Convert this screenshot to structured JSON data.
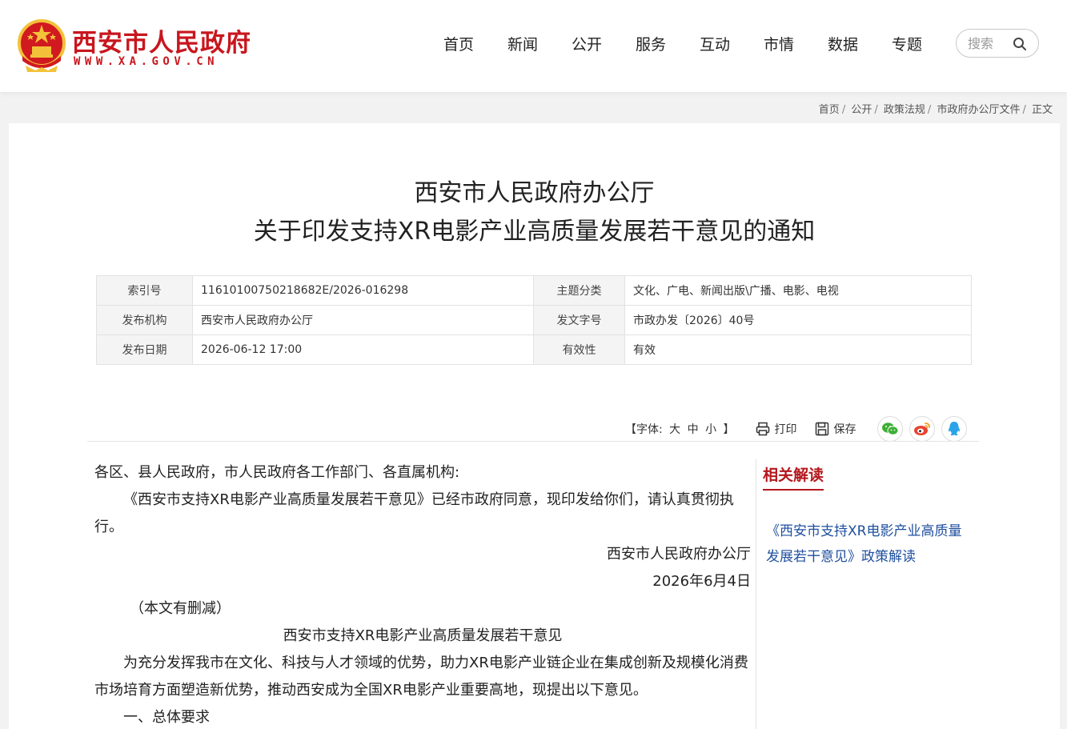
{
  "header": {
    "logo_title": "西安市人民政府",
    "logo_url": "WWW.XA.GOV.CN",
    "nav": [
      "首页",
      "新闻",
      "公开",
      "服务",
      "互动",
      "市情",
      "数据",
      "专题"
    ],
    "search_placeholder": "搜索"
  },
  "breadcrumb": [
    "首页",
    "公开",
    "政策法规",
    "市政府办公厅文件",
    "正文"
  ],
  "document": {
    "title_line1": "西安市人民政府办公厅",
    "title_line2": "关于印发支持XR电影产业高质量发展若干意见的通知",
    "meta": [
      {
        "k1": "索引号",
        "v1": "11610100750218682E/2026-016298",
        "k2": "主题分类",
        "v2": "文化、广电、新闻出版\\广播、电影、电视"
      },
      {
        "k1": "发布机构",
        "v1": "西安市人民政府办公厅",
        "k2": "发文字号",
        "v2": "市政办发〔2026〕40号"
      },
      {
        "k1": "发布日期",
        "v1": "2026-06-12 17:00",
        "k2": "有效性",
        "v2": "有效"
      }
    ]
  },
  "tools": {
    "font_label": "【字体:",
    "font_large": "大",
    "font_medium": "中",
    "font_small": "小",
    "font_close": "】",
    "print": "打印",
    "save": "保存"
  },
  "article": {
    "salutation": "各区、县人民政府，市人民政府各工作部门、各直属机构:",
    "para1": "《西安市支持XR电影产业高质量发展若干意见》已经市政府同意，现印发给你们，请认真贯彻执行。",
    "signature": "西安市人民政府办公厅",
    "date": "2026年6月4日",
    "note": "（本文有删减）",
    "subtitle": "西安市支持XR电影产业高质量发展若干意见",
    "para2": "为充分发挥我市在文化、科技与人才领域的优势，助力XR电影产业链企业在集成创新及规模化消费市场培育方面塑造新优势，推动西安成为全国XR电影产业重要高地，现提出以下意见。",
    "heading1": "一、总体要求"
  },
  "sidebar": {
    "title": "相关解读",
    "link": "《西安市支持XR电影产业高质量发展若干意见》政策解读"
  },
  "colors": {
    "brand_red": "#c8161d",
    "link_blue": "#1f4f9e"
  }
}
